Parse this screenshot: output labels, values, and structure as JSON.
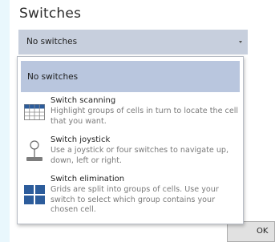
{
  "section": {
    "title": "Switches"
  },
  "select": {
    "value": "No switches"
  },
  "dropdown": {
    "options": [
      {
        "label": "No switches",
        "selected": true
      },
      {
        "title": "Switch scanning",
        "desc": "Highlight groups of cells in turn to locate the cell that you want.",
        "icon": "grid-icon"
      },
      {
        "title": "Switch joystick",
        "desc": "Use a joystick or four switches to navigate up, down, left or right.",
        "icon": "joystick-icon"
      },
      {
        "title": "Switch elimination",
        "desc": "Grids are split into groups of cells. Use your switch to select which group contains your chosen cell.",
        "icon": "quad-grid-icon"
      }
    ]
  },
  "buttons": {
    "ok": "OK"
  },
  "colors": {
    "selected_bg": "#b9c6de",
    "select_bg": "#c7cfdd",
    "icon_blue": "#2c5c9b",
    "page_bg": "#e9f7fd"
  }
}
